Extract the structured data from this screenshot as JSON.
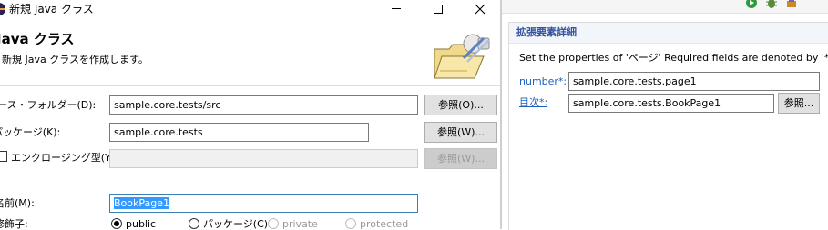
{
  "dialog": {
    "title": "新規 Java クラス",
    "banner_title": "Java クラス",
    "banner_description": "新規 Java クラスを作成します。",
    "fields": {
      "source_folder": {
        "label": "ソース・フォルダー(D):",
        "value": "sample.core.tests/src",
        "browse_label": "参照(O)..."
      },
      "package": {
        "label": "パッケージ(K):",
        "value": "sample.core.tests",
        "browse_label": "参照(W)..."
      },
      "enclosing": {
        "label": "エンクロージング型(Y):",
        "value": "",
        "browse_label": "参照(W)..."
      },
      "name": {
        "label": "名前(M):",
        "value": "BookPage1"
      },
      "modifiers": {
        "label": "修飾子:",
        "options": [
          "public",
          "パッケージ(C)",
          "private",
          "protected"
        ],
        "selected": "public"
      }
    }
  },
  "panel": {
    "section_title": "拡張要素詳細",
    "description": "Set the properties of 'ページ' Required fields are denoted by '*'.",
    "rows": [
      {
        "label": "number*:",
        "value": "sample.core.tests.page1"
      },
      {
        "label": "目次*:",
        "value": "sample.core.tests.BookPage1",
        "browse_label": "参照..."
      }
    ]
  },
  "colors": {
    "accent": "#1f5fbf",
    "selection": "#3399ff",
    "section_header_bg": "#f2f6fb"
  },
  "icons": [
    "app-icon",
    "minimize-icon",
    "maximize-icon",
    "close-icon",
    "folder-wizard-icon",
    "run-icon",
    "bug-icon",
    "tools-icon"
  ]
}
